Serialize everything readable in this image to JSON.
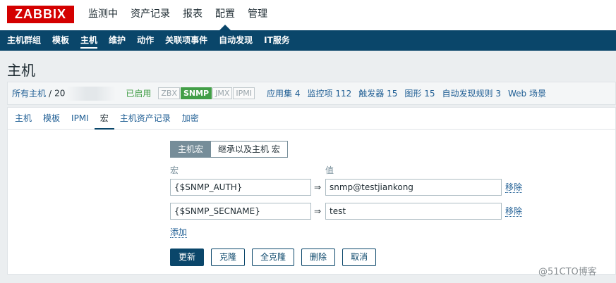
{
  "logo": "ZABBIX",
  "top_menu": [
    "监测中",
    "资产记录",
    "报表",
    "配置",
    "管理"
  ],
  "sub_menu": [
    "主机群组",
    "模板",
    "主机",
    "维护",
    "动作",
    "关联项事件",
    "自动发现",
    "IT服务"
  ],
  "page_title": "主机",
  "host_nav": {
    "all_hosts": "所有主机",
    "separator": "/",
    "host_prefix": "20",
    "status": "已启用",
    "badges": [
      "ZBX",
      "SNMP",
      "JMX",
      "IPMI"
    ],
    "items": [
      {
        "label": "应用集",
        "count": "4"
      },
      {
        "label": "监控项",
        "count": "112"
      },
      {
        "label": "触发器",
        "count": "15"
      },
      {
        "label": "图形",
        "count": "15"
      },
      {
        "label": "自动发现规则",
        "count": "3"
      },
      {
        "label": "Web 场景",
        "count": ""
      }
    ]
  },
  "tabs": [
    "主机",
    "模板",
    "IPMI",
    "宏",
    "主机资产记录",
    "加密"
  ],
  "macro_toggle": {
    "host": "主机宏",
    "inherited": "继承以及主机 宏"
  },
  "columns": {
    "macro": "宏",
    "value": "值"
  },
  "macros": [
    {
      "macro": "{$SNMP_AUTH}",
      "value": "snmp@testjiankong",
      "remove": "移除"
    },
    {
      "macro": "{$SNMP_SECNAME}",
      "value": "test",
      "remove": "移除"
    }
  ],
  "add_label": "添加",
  "actions": {
    "update": "更新",
    "clone": "克隆",
    "full_clone": "全克隆",
    "delete": "删除",
    "cancel": "取消"
  },
  "watermark": "@51CTO博客",
  "colors": {
    "header_bg": "#0a466a",
    "logo_red": "#d40000",
    "enabled_green": "#429e47",
    "link_blue": "#1f5e94"
  }
}
